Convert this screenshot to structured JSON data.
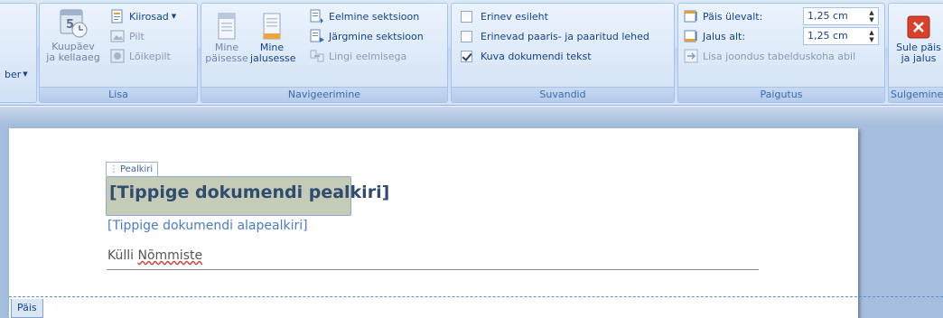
{
  "ribbon": {
    "groups": {
      "lisa": {
        "label": "Lisa",
        "partial_left_label": "ber",
        "date_time": "Kuupäev ja kellaaeg",
        "date_time_line1": "Kuupäev",
        "date_time_line2": "ja kellaaeg",
        "quick_parts": "Kiirosad",
        "picture": "Pilt",
        "clip_art": "Lõikepilt"
      },
      "navigeerimine": {
        "label": "Navigeerimine",
        "goto_header_line1": "Mine",
        "goto_header_line2": "päisesse",
        "goto_footer_line1": "Mine",
        "goto_footer_line2": "jalusesse",
        "prev_section": "Eelmine sektsioon",
        "next_section": "Järgmine sektsioon",
        "link_previous": "Lingi eelmisega"
      },
      "suvandid": {
        "label": "Suvandid",
        "options": [
          {
            "label": "Erinev esileht",
            "checked": false
          },
          {
            "label": "Erinevad paaris- ja paaritud lehed",
            "checked": false
          },
          {
            "label": "Kuva dokumendi tekst",
            "checked": true
          }
        ]
      },
      "paigutus": {
        "label": "Paigutus",
        "header_top_label": "Päis ülevalt:",
        "header_top_value": "1,25 cm",
        "footer_bottom_label": "Jalus alt:",
        "footer_bottom_value": "1,25 cm",
        "insert_alignment_tab": "Lisa joondus tabelduskoha abil"
      },
      "sulgemine": {
        "label": "Sulgemine",
        "close_line1": "Sule päis",
        "close_line2": "ja jalus"
      }
    }
  },
  "document": {
    "content_control_tag": "Pealkiri",
    "title_placeholder": "[Tippige dokumendi pealkiri]",
    "subtitle_placeholder": "[Tippige dokumendi alapealkiri]",
    "author_first": "Külli",
    "author_last": "Nõmmiste",
    "header_tag": "Päis"
  },
  "colors": {
    "ribbon_text": "#15428b",
    "title_bg": "#c4cbb6",
    "subtitle": "#4a7cc6",
    "close_red": "#d9412b"
  }
}
